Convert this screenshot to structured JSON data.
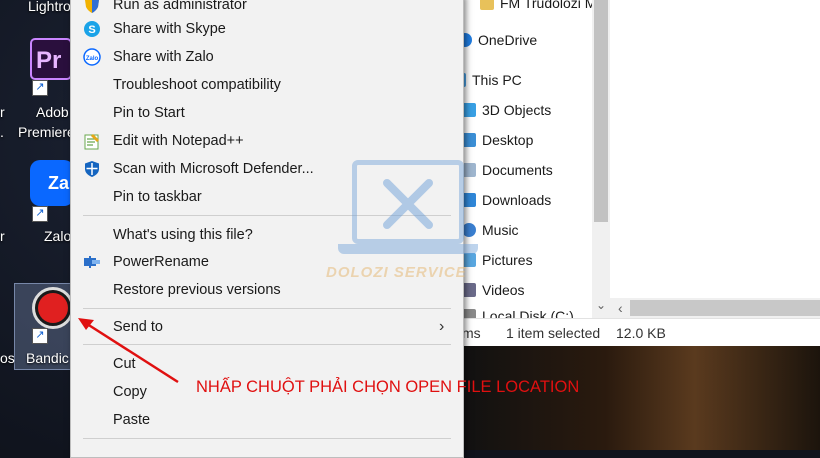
{
  "desktop": {
    "icons": [
      {
        "label": "Lightro",
        "name": "lightroom"
      },
      {
        "label": "Adob",
        "name": "adobe-premiere"
      },
      {
        "label": "Premiere",
        "name": "adobe-premiere-line2"
      },
      {
        "label": "Zalo",
        "name": "zalo"
      },
      {
        "label": "Bandic",
        "name": "bandicam"
      }
    ],
    "edge_labels": [
      "r",
      ".",
      "r",
      "os"
    ],
    "premiere_glyph": "Pr",
    "zalo_glyph": "Zal"
  },
  "context_menu": {
    "items": [
      {
        "label": "Run as administrator",
        "icon": "shield-icon"
      },
      {
        "label": "Share with Skype",
        "icon": "skype-icon"
      },
      {
        "label": "Share with Zalo",
        "icon": "zalo-icon"
      },
      {
        "label": "Troubleshoot compatibility",
        "icon": ""
      },
      {
        "label": "Pin to Start",
        "icon": ""
      },
      {
        "label": "Edit with Notepad++",
        "icon": "notepad-plus-plus-icon"
      },
      {
        "label": "Scan with Microsoft Defender...",
        "icon": "defender-icon"
      },
      {
        "label": "Pin to taskbar",
        "icon": ""
      },
      {
        "label": "What's using this file?",
        "icon": ""
      },
      {
        "label": "PowerRename",
        "icon": "powerrename-icon"
      },
      {
        "label": "Restore previous versions",
        "icon": ""
      },
      {
        "label": "Send to",
        "icon": ""
      },
      {
        "label": "Cut",
        "icon": ""
      },
      {
        "label": "Copy",
        "icon": ""
      },
      {
        "label": "Paste",
        "icon": ""
      }
    ],
    "submenu_arrow": "›"
  },
  "explorer": {
    "nav_items": [
      {
        "label": "FM Trudolozi Mo",
        "icon": "folder-icon"
      },
      {
        "label": "OneDrive",
        "icon": "onedrive-icon"
      },
      {
        "label": "This PC",
        "icon": "this-pc-icon"
      },
      {
        "label": "3D Objects",
        "icon": "3d-objects-icon"
      },
      {
        "label": "Desktop",
        "icon": "desktop-folder-icon"
      },
      {
        "label": "Documents",
        "icon": "documents-icon"
      },
      {
        "label": "Downloads",
        "icon": "downloads-icon"
      },
      {
        "label": "Music",
        "icon": "music-icon"
      },
      {
        "label": "Pictures",
        "icon": "pictures-icon"
      },
      {
        "label": "Videos",
        "icon": "videos-icon"
      },
      {
        "label": "Local Disk (C:)",
        "icon": "drive-icon"
      }
    ],
    "status": {
      "items_count": "ms",
      "selected": "1 item selected",
      "size": "12.0 KB"
    }
  },
  "watermark": {
    "text": "DOLOZI SERVICE"
  },
  "annotation": {
    "text": "NHẤP CHUỘT PHẢI CHỌN OPEN FILE LOCATION",
    "color": "#e01010"
  },
  "colors": {
    "menu_bg": "#f2f2f2",
    "accent": "#0a68ff"
  }
}
